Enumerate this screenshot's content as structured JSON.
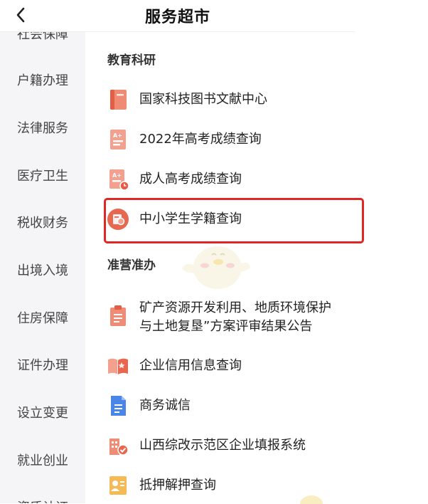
{
  "header": {
    "title": "服务超市",
    "back": "‹"
  },
  "sidebar": {
    "items": [
      {
        "label": "社会保障"
      },
      {
        "label": "户籍办理"
      },
      {
        "label": "法律服务"
      },
      {
        "label": "医疗卫生"
      },
      {
        "label": "税收财务"
      },
      {
        "label": "出境入境"
      },
      {
        "label": "住房保障"
      },
      {
        "label": "证件办理"
      },
      {
        "label": "设立变更"
      },
      {
        "label": "就业创业"
      },
      {
        "label": "资质认证"
      }
    ]
  },
  "sections": [
    {
      "title": "教育科研",
      "items": [
        {
          "label": "国家科技图书文献中心",
          "icon": "book-icon"
        },
        {
          "label": "2022年高考成绩查询",
          "icon": "score-sheet-icon"
        },
        {
          "label": "成人高考成绩查询",
          "icon": "score-sheet-clock-icon"
        },
        {
          "label": "中小学生学籍查询",
          "icon": "student-record-icon"
        }
      ]
    },
    {
      "title": "准营准办",
      "items": [
        {
          "label_lines": [
            "矿产资源开发利用、地质环境保护",
            "与土地复垦”方案评审结果公告"
          ],
          "icon": "clipboard-icon"
        },
        {
          "label": "企业信用信息查询",
          "icon": "open-book-icon"
        },
        {
          "label": "商务诚信",
          "icon": "document-icon"
        },
        {
          "label": "山西综改示范区企业填报系统",
          "icon": "building-check-icon"
        },
        {
          "label": "抵押解押查询",
          "icon": "id-card-icon"
        }
      ]
    }
  ],
  "colors": {
    "accent": "#e8674f",
    "highlight": "#e12626",
    "sidebar_bg": "#f5f5f7",
    "blue_icon": "#4a86e8"
  }
}
